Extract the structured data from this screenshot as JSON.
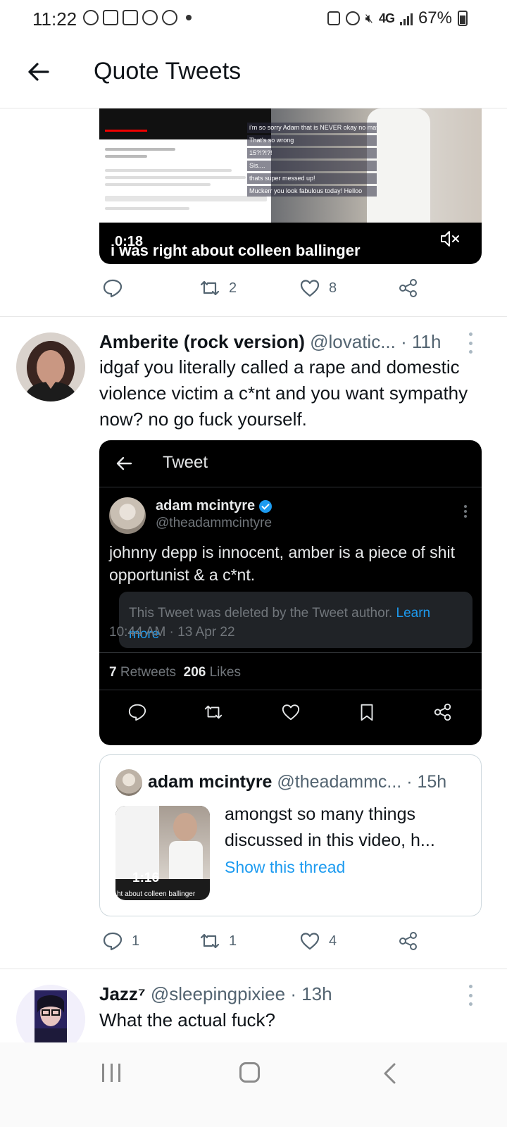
{
  "status_bar": {
    "time": "11:22",
    "network": "4G",
    "battery": "67%"
  },
  "header": {
    "title": "Quote Tweets"
  },
  "top_video": {
    "duration": "0:18",
    "caption": "i was right about colleen ballinger",
    "chat_lines": [
      "i'm so sorry Adam that is NEVER okay no matter how you slice it...",
      "That's so wrong",
      "15?!?!?!",
      "Sis....",
      "thats super messed up!",
      "Muckerr you look fabulous today! Helloo"
    ],
    "replies": "",
    "retweets": "2",
    "likes": "8"
  },
  "tweet1": {
    "name": "Amberite (rock version)",
    "handle": "@lovatic...",
    "time": "· 11h",
    "text": "idgaf you literally called a rape and domestic violence victim a c*nt and you want sympathy now? no go fuck yourself.",
    "embedded": {
      "title": "Tweet",
      "name": "adam mcintyre",
      "handle": "@theadammcintyre",
      "text": "johnny depp is innocent, amber is a piece of shit opportunist & a c*nt.",
      "deleted_notice": "This Tweet was deleted by the Tweet author.",
      "learn_more": "Learn more",
      "date": "10:44 AM · 13 Apr 22",
      "retweets_count": "7",
      "retweets_label": "Retweets",
      "likes_count": "206",
      "likes_label": "Likes"
    },
    "quoted": {
      "name": "adam mcintyre",
      "handle": "@theadammc...",
      "time": "· 15h",
      "text": "amongst so many things discussed in this video, h...",
      "link": "Show this thread",
      "thumb_duration": "1:16",
      "thumb_caption": "ht about colleen ballinger"
    },
    "replies": "1",
    "retweets": "1",
    "likes": "4"
  },
  "tweet2": {
    "name": "Jazz⁷",
    "handle": "@sleepingpixiee",
    "time": "· 13h",
    "text": "What the actual fuck?"
  }
}
